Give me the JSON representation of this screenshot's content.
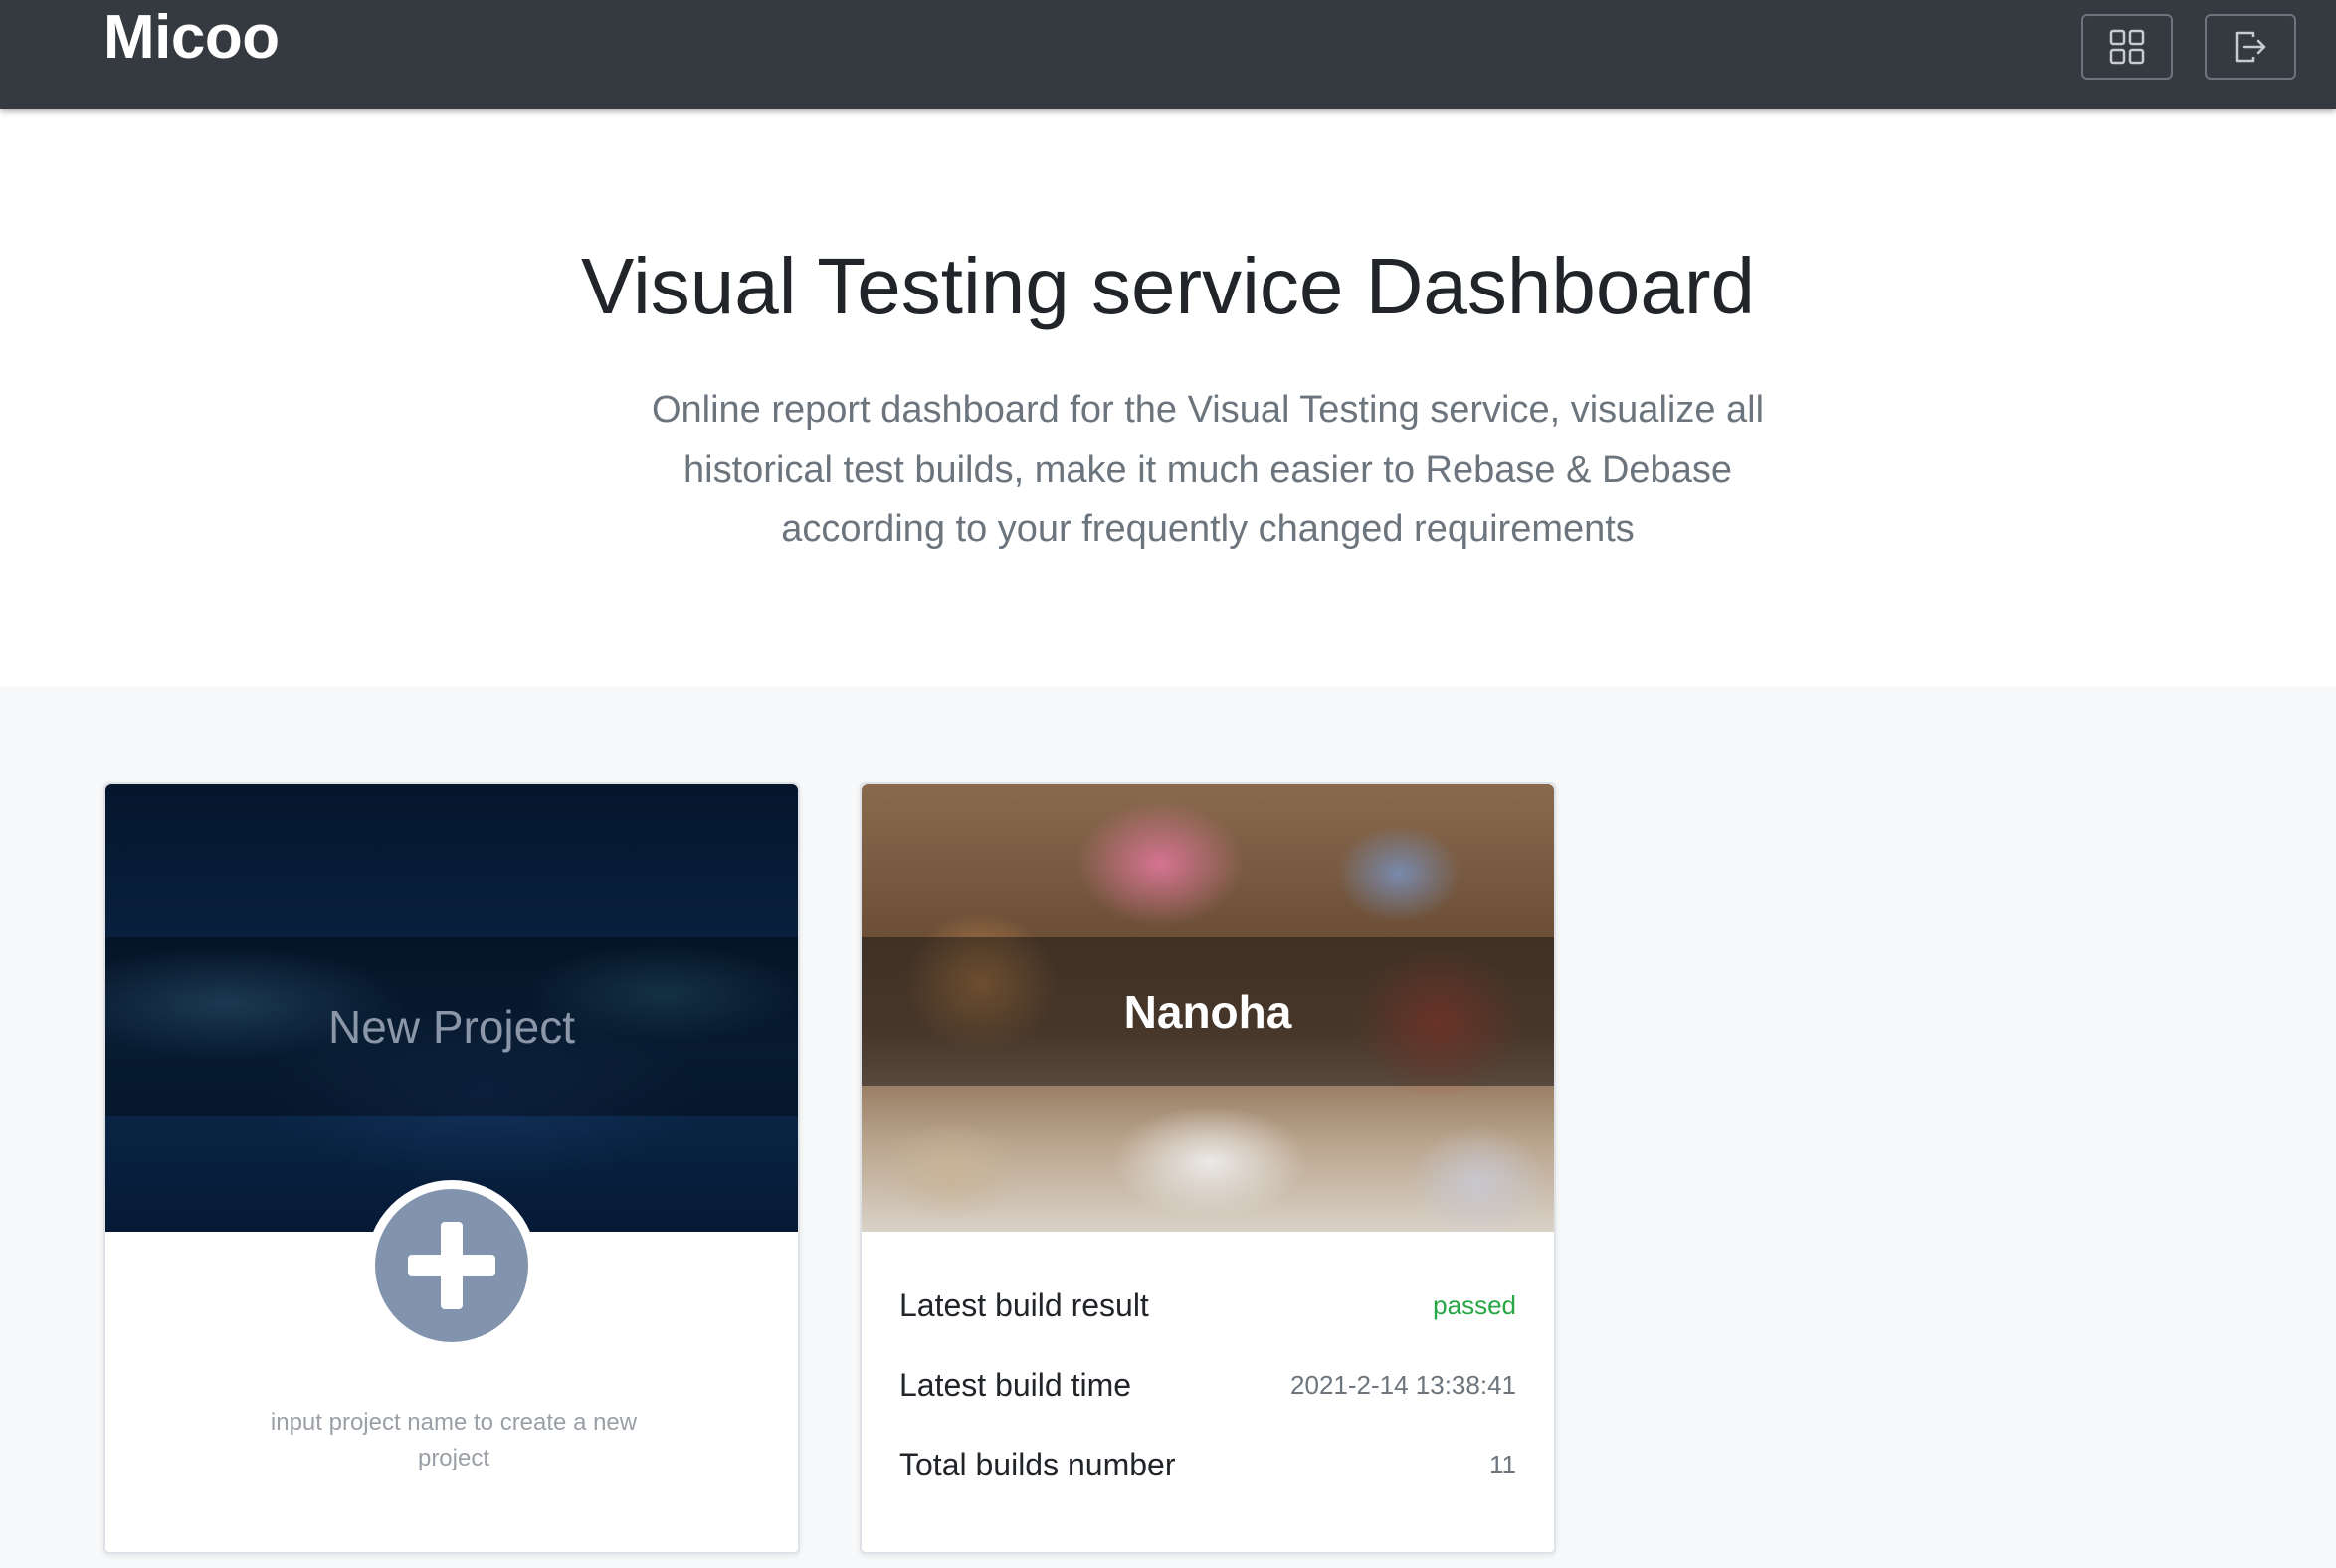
{
  "navbar": {
    "brand": "Micoo",
    "icons": [
      "grid-icon",
      "logout-icon"
    ]
  },
  "hero": {
    "title": "Visual Testing service Dashboard",
    "subtitle": "Online report dashboard for the Visual Testing service, visualize all historical test builds, make it much easier to Rebase & Debase according to your frequently changed requirements"
  },
  "new_project_card": {
    "title": "New Project",
    "hint": "input project name to create a new project",
    "icon": "plus-icon"
  },
  "projects": [
    {
      "name": "Nanoha",
      "stats": [
        {
          "label": "Latest build result",
          "value": "passed"
        },
        {
          "label": "Latest build time",
          "value": "2021-2-14 13:38:41"
        },
        {
          "label": "Total builds number",
          "value": "11"
        }
      ]
    }
  ],
  "colors": {
    "navbar": "#343a40",
    "passed": "#28a745",
    "plus_circle": "#8294ad"
  }
}
